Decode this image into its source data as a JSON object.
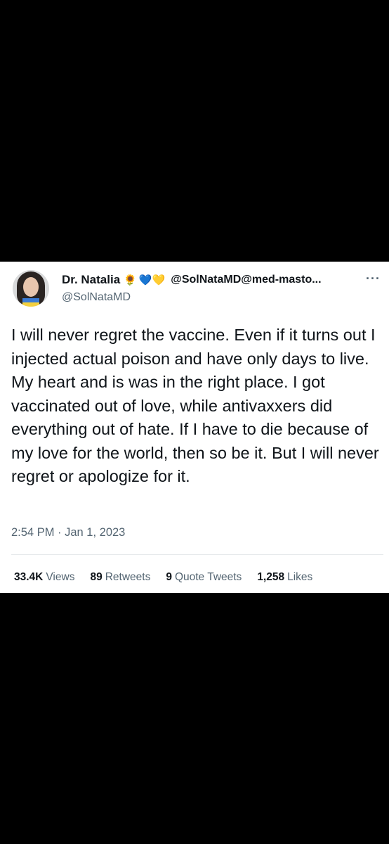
{
  "tweet": {
    "display_name": "Dr. Natalia",
    "emojis": [
      "🌻",
      "💙",
      "💛"
    ],
    "handle_long": "@SolNataMD@med-masto...",
    "handle": "@SolNataMD",
    "more_icon": "···",
    "text": "I will never regret the vaccine. Even if it turns out I injected actual poison and have only days to live. My heart and is was in the right place. I got vaccinated out of love, while antivaxxers did everything out of hate. If I have to die because of my love for the world, then so be it. But I will never regret or apologize for it.",
    "timestamp": "2:54 PM · Jan 1, 2023",
    "stats": {
      "views": {
        "num": "33.4K",
        "label": "Views"
      },
      "retweets": {
        "num": "89",
        "label": "Retweets"
      },
      "quotes": {
        "num": "9",
        "label": "Quote Tweets"
      },
      "likes": {
        "num": "1,258",
        "label": "Likes"
      }
    }
  }
}
